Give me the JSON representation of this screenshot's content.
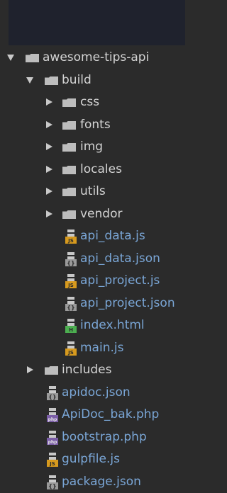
{
  "tree": {
    "root": {
      "label": "awesome-tips-api",
      "expanded": true
    },
    "build": {
      "label": "build",
      "expanded": true
    },
    "build_folders": [
      {
        "label": "css"
      },
      {
        "label": "fonts"
      },
      {
        "label": "img"
      },
      {
        "label": "locales"
      },
      {
        "label": "utils"
      },
      {
        "label": "vendor"
      }
    ],
    "build_files": [
      {
        "label": "api_data.js",
        "icon": "js-file-icon"
      },
      {
        "label": "api_data.json",
        "icon": "json-file-icon"
      },
      {
        "label": "api_project.js",
        "icon": "js-file-icon"
      },
      {
        "label": "api_project.json",
        "icon": "json-file-icon"
      },
      {
        "label": "index.html",
        "icon": "html-file-icon"
      },
      {
        "label": "main.js",
        "icon": "js-file-icon"
      }
    ],
    "includes": {
      "label": "includes",
      "expanded": false
    },
    "root_files": [
      {
        "label": "apidoc.json",
        "icon": "json-file-icon"
      },
      {
        "label": "ApiDoc_bak.php",
        "icon": "php-file-icon"
      },
      {
        "label": "bootstrap.php",
        "icon": "php-file-icon"
      },
      {
        "label": "gulpfile.js",
        "icon": "js-file-icon"
      },
      {
        "label": "package.json",
        "icon": "json-file-icon"
      }
    ]
  },
  "colors": {
    "background": "#2b2b2b",
    "topbar": "#1f222d",
    "folder_text": "#d4d4d4",
    "file_text": "#7aa6d6",
    "folder_icon": "#bdbdbd"
  }
}
